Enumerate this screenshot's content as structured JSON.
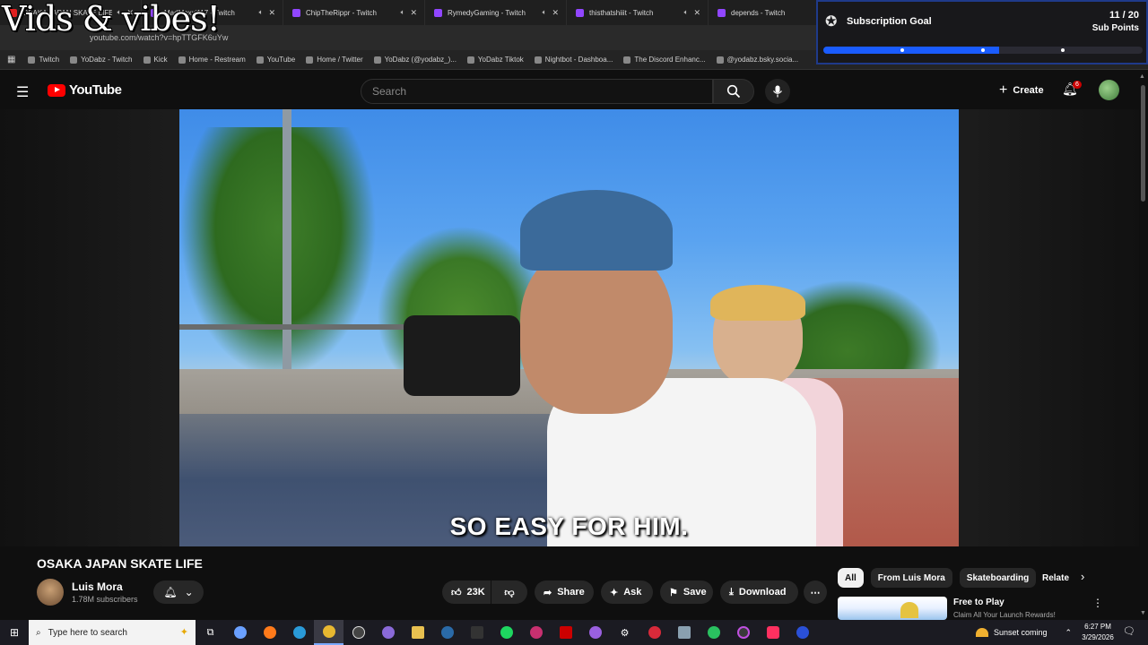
{
  "overlay_text": "Vids & vibes!",
  "browser": {
    "tabs": [
      {
        "title": "OSAKA JAPAN SKATE LIFE",
        "kind": "yt"
      },
      {
        "title": "MadMoxxi117 - Twitch",
        "kind": "twitch"
      },
      {
        "title": "ChipTheRippr - Twitch",
        "kind": "twitch"
      },
      {
        "title": "RymedyGaming - Twitch",
        "kind": "twitch"
      },
      {
        "title": "thisthatshiiit - Twitch",
        "kind": "twitch"
      },
      {
        "title": "depends - Twitch",
        "kind": "twitch"
      }
    ],
    "address": "youtube.com/watch?v=hpTTGFK6uYw",
    "bookmarks": [
      "Twitch",
      "YoDabz - Twitch",
      "Kick",
      "Home - Restream",
      "YouTube",
      "Home / Twitter",
      "YoDabz (@yodabz_)...",
      "YoDabz Tiktok",
      "Nightbot - Dashboa...",
      "The Discord Enhanc...",
      "@yodabz.bsky.socia..."
    ]
  },
  "goal": {
    "title": "Subscription Goal",
    "count": "11 / 20",
    "unit": "Sub Points",
    "progress": 0.55,
    "accent": "#1a5cff"
  },
  "youtube": {
    "logo": "YouTube",
    "search_placeholder": "Search",
    "create_label": "Create",
    "notif_count": "6"
  },
  "video": {
    "caption": "SO EASY FOR HIM.",
    "title": "OSAKA JAPAN SKATE LIFE",
    "channel": "Luis Mora",
    "subscribers": "1.78M subscribers",
    "likes": "23K",
    "share_label": "Share",
    "ask_label": "Ask",
    "save_label": "Save",
    "download_label": "Download"
  },
  "sidebar": {
    "chips": [
      "All",
      "From Luis Mora",
      "Skateboarding"
    ],
    "chip_partial": "Relate",
    "rec_title": "Free to Play",
    "rec_sub": "Claim All Your Launch Rewards!"
  },
  "taskbar": {
    "search_placeholder": "Type here to search",
    "weather": "Sunset coming",
    "time": "6:27 PM",
    "date": "3/29/2026"
  }
}
